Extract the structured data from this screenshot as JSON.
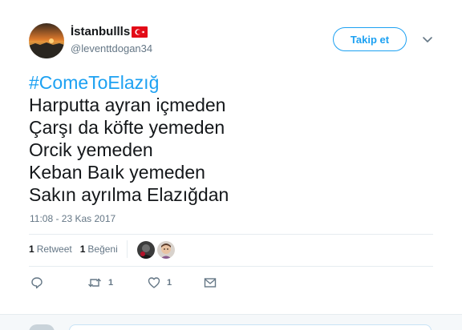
{
  "user": {
    "display_name": "İstanbullls",
    "flag_icon": "turkey-flag-icon",
    "handle": "@leventtdogan34",
    "avatar_icon": "sunset-landscape-avatar"
  },
  "header": {
    "follow_label": "Takip et",
    "more_icon": "chevron-down-icon"
  },
  "tweet": {
    "hashtag": "#ComeToElazığ",
    "lines": [
      "Harputta ayran içmeden",
      "Çarşı da köfte yemeden",
      "Orcik yemeden",
      "Keban Baık yemeden",
      "Sakın ayrılma Elazığdan"
    ],
    "timestamp": "11:08 - 23 Kas 2017"
  },
  "stats": {
    "retweets_count": "1",
    "retweets_label": "Retweet",
    "likes_count": "1",
    "likes_label": "Beğeni"
  },
  "actions": {
    "reply_icon": "reply-icon",
    "retweet_icon": "retweet-icon",
    "retweet_count": "1",
    "like_icon": "heart-icon",
    "like_count": "1",
    "dm_icon": "envelope-icon"
  },
  "colors": {
    "accent": "#1da1f2",
    "text": "#14171a",
    "muted": "#657786",
    "divider": "#e6ecf0"
  }
}
